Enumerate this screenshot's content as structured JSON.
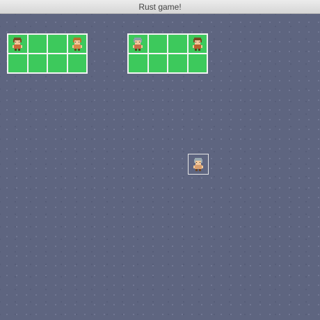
{
  "window": {
    "title": "Rust game!"
  },
  "colors": {
    "background": "#5e6580",
    "cell": "#3dc95c",
    "grid_lines": "#f4f4f4"
  },
  "boards": [
    {
      "rows": 2,
      "cols": 4,
      "occupied": [
        {
          "row": 0,
          "col": 0,
          "sprite": "character-icon"
        },
        {
          "row": 0,
          "col": 3,
          "sprite": "character-icon"
        }
      ]
    },
    {
      "rows": 2,
      "cols": 4,
      "occupied": [
        {
          "row": 0,
          "col": 0,
          "sprite": "character-icon"
        },
        {
          "row": 0,
          "col": 3,
          "sprite": "character-icon"
        }
      ]
    }
  ],
  "selected_unit": {
    "sprite": "character-icon"
  }
}
